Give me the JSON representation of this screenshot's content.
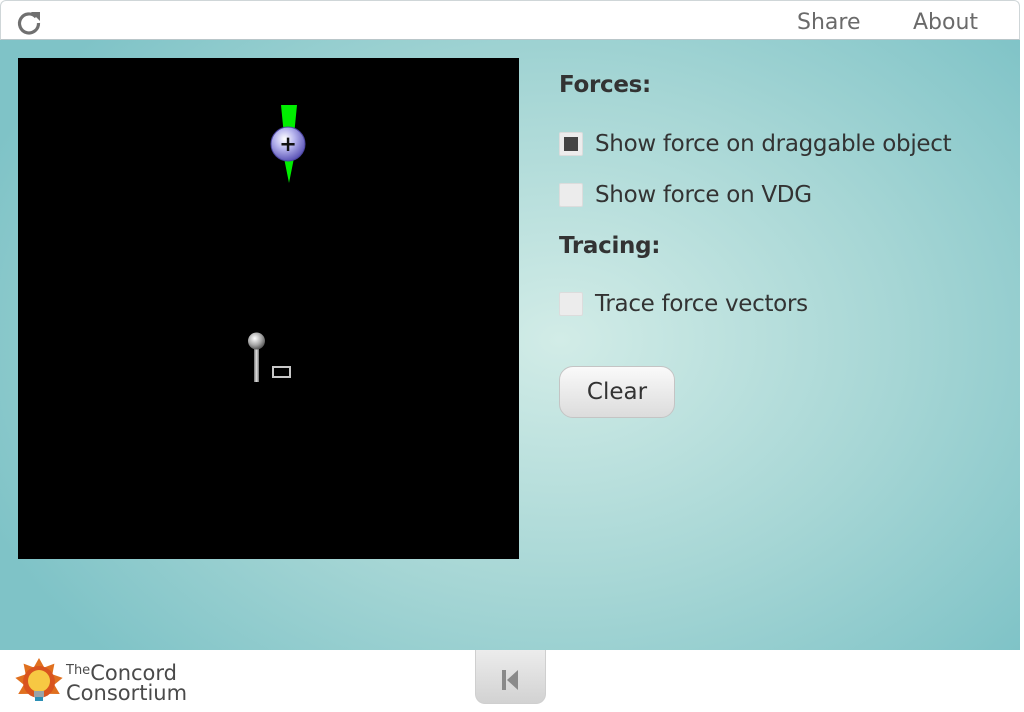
{
  "topbar": {
    "reload_icon": "reload-icon",
    "share_label": "Share",
    "about_label": "About"
  },
  "model": {
    "background": "#000000",
    "draggable_charge_symbol": "+",
    "force_vector_color": "#00ee00"
  },
  "controls": {
    "forces_title": "Forces:",
    "show_force_draggable": {
      "label": "Show force on draggable object",
      "checked": true
    },
    "show_force_vdg": {
      "label": "Show force on VDG",
      "checked": false
    },
    "tracing_title": "Tracing:",
    "trace_force_vectors": {
      "label": "Trace force vectors",
      "checked": false
    },
    "clear_label": "Clear"
  },
  "footer": {
    "logo_the": "The",
    "logo_concord": "Concord",
    "logo_consortium": "Consortium",
    "reset_icon": "skip-back-icon"
  }
}
